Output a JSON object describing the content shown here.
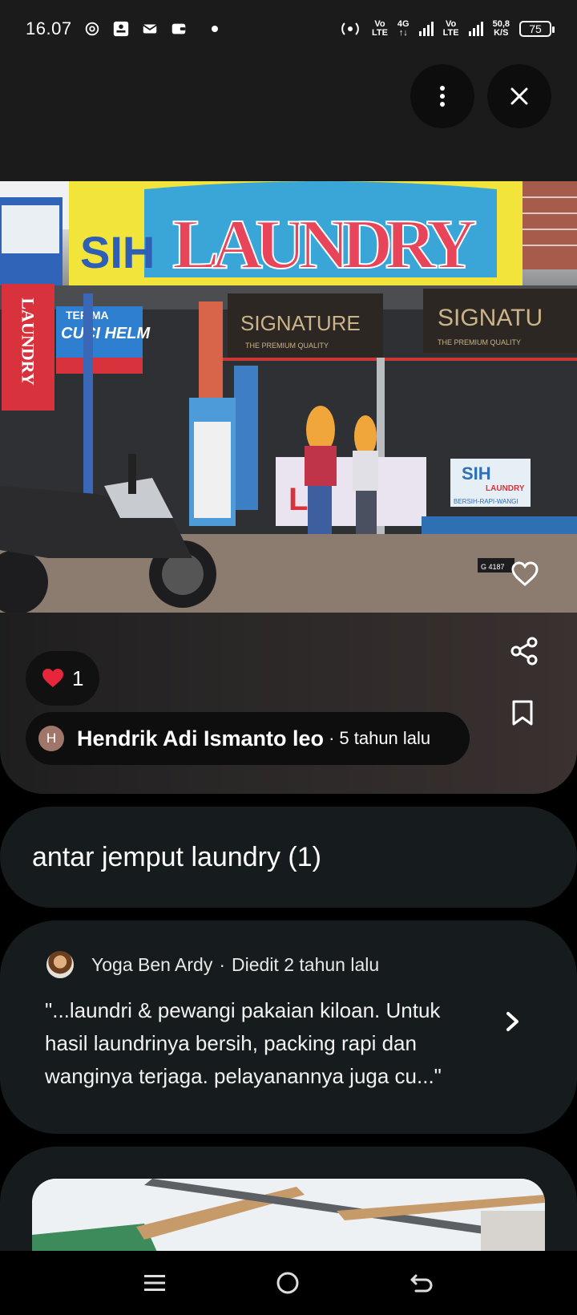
{
  "status_bar": {
    "time": "16.07",
    "network_1_top": "Vo",
    "network_1_bottom": "LTE",
    "network_2_top": "4G",
    "network_3_top": "Vo",
    "network_3_bottom": "LTE",
    "speed_value": "50,8",
    "speed_unit": "K/S",
    "battery": "75",
    "icons": [
      "chatgpt-icon",
      "tiket-icon",
      "mail-icon",
      "wallet-icon",
      "notification-dot",
      "hotspot-icon",
      "signal-icon",
      "battery-icon"
    ]
  },
  "header": {
    "more_icon": "more-vertical-icon",
    "close_icon": "close-icon"
  },
  "photo": {
    "banner_main": "LAUNDRY",
    "banner_prefix": "SIH",
    "side_sign": "LAUNDRY",
    "signature_1": "SIGNATURE",
    "signature_2": "SIGNATU",
    "signature_sub": "THE PREMIUM QUALITY",
    "promo_sign_line1": "TERIMA",
    "promo_sign_line2": "CUCI HELM",
    "small_sign_top": "SIH",
    "small_sign_main": "LAUNDRY",
    "small_sign_sub": "BERSIH-RAPI-WANGI",
    "plate": "G 4187",
    "favorite_icon": "heart-outline-icon"
  },
  "info": {
    "likes_count": "1",
    "likes_icon": "heart-emoji",
    "author_initial": "H",
    "author_name": "Hendrik Adi Ismanto leo",
    "separator": "·",
    "author_time": "5 tahun lalu",
    "share_icon": "share-icon",
    "bookmark_icon": "bookmark-icon"
  },
  "title_card": {
    "title": "antar jemput laundry (1)"
  },
  "review": {
    "author": "Yoga Ben Ardy",
    "separator": "·",
    "time": "Diedit 2 tahun lalu",
    "text_line1": "\"...laundri & pewangi pakaian kiloan. Untuk",
    "text_line2": "hasil laundrinya bersih, packing rapi dan",
    "text_line3": "wanginya terjaga. pelayanannya juga cu...\"",
    "chevron_icon": "chevron-right-icon"
  },
  "nav": {
    "icons": [
      "menu-icon",
      "home-icon",
      "back-icon"
    ]
  }
}
